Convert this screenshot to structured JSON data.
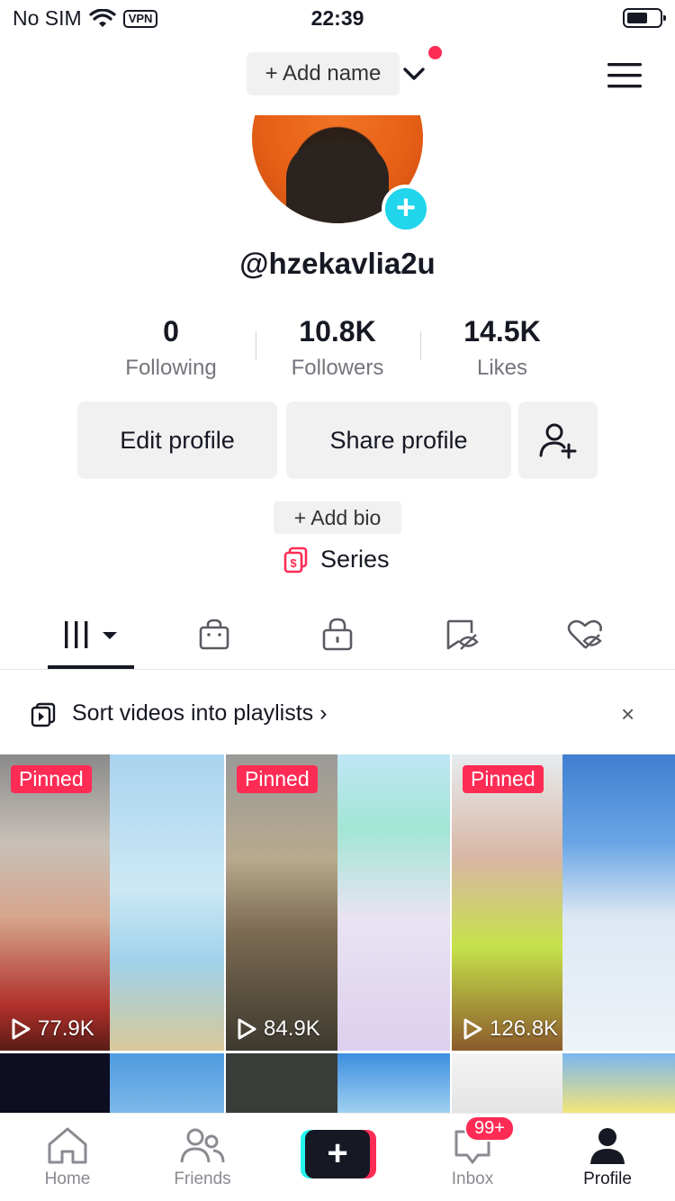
{
  "status_bar": {
    "carrier": "No SIM",
    "vpn": "VPN",
    "time": "22:39"
  },
  "header": {
    "add_name": "+ Add name"
  },
  "profile": {
    "username": "@hzekavlia2u",
    "stats": [
      {
        "value": "0",
        "label": "Following"
      },
      {
        "value": "10.8K",
        "label": "Followers"
      },
      {
        "value": "14.5K",
        "label": "Likes"
      }
    ],
    "edit_profile": "Edit profile",
    "share_profile": "Share profile",
    "add_bio": "+ Add bio",
    "series": "Series"
  },
  "tabs": [
    "videos-tab",
    "shop-tab",
    "private-tab",
    "reposts-hidden-tab",
    "liked-hidden-tab"
  ],
  "playlist_banner": {
    "text": "Sort videos into playlists",
    "close": "×"
  },
  "videos": [
    {
      "pinned": "Pinned",
      "views": "77.9K"
    },
    {
      "pinned": "Pinned",
      "views": "84.9K"
    },
    {
      "pinned": "Pinned",
      "views": "126.8K"
    }
  ],
  "bottom_nav": {
    "home": "Home",
    "friends": "Friends",
    "create": "+",
    "inbox": "Inbox",
    "inbox_badge": "99+",
    "profile": "Profile"
  },
  "colors": {
    "accent_red": "#fe2c55",
    "accent_cyan": "#25f4ee",
    "text": "#161823"
  }
}
